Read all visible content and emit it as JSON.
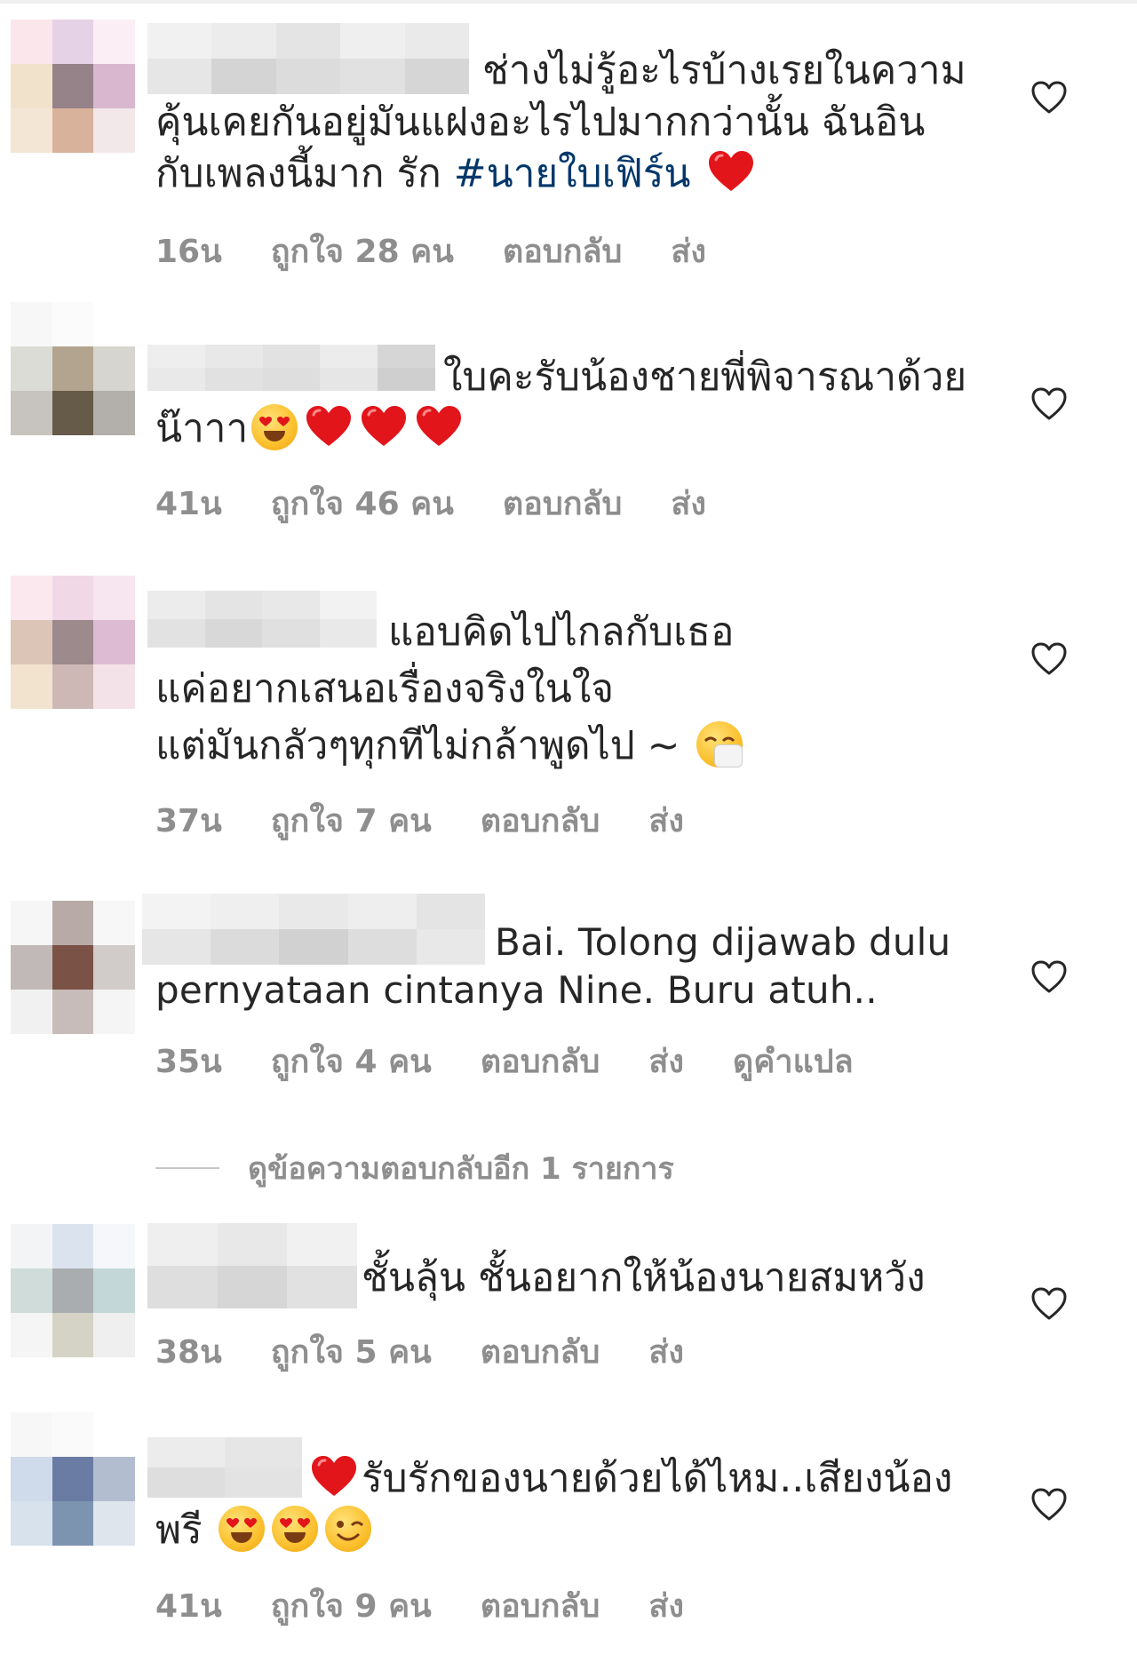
{
  "colors": {
    "text": "#262626",
    "meta": "#8e8e8e",
    "hashtag": "#00376b",
    "heart": "#e2151b"
  },
  "icons": {
    "like": "heart-outline-icon",
    "red_heart": "red-heart-emoji",
    "heart_eyes": "heart-eyes-emoji",
    "sneeze": "sneezing-face-emoji",
    "wink": "winking-face-emoji"
  },
  "comments": [
    {
      "lines": [
        "ช่างไม่รู้อะไรบ้างเรยในความ",
        "คุ้นเคยกันอยู่มันแฝงอะไรไปมากกว่านั้น  ฉันอิน",
        "กับเพลงนี้มาก รัก "
      ],
      "hashtag": "#นายใบเฟิร์น",
      "time": "16น",
      "likes": "ถูกใจ 28 คน",
      "reply": "ตอบกลับ",
      "send": "ส่ง"
    },
    {
      "lines": [
        "ใบคะรับน้องชายพี่พิจารณาด้วย",
        "น๊าาา"
      ],
      "time": "41น",
      "likes": "ถูกใจ 46 คน",
      "reply": "ตอบกลับ",
      "send": "ส่ง"
    },
    {
      "lines": [
        "แอบคิดไปไกลกับเธอ",
        "แค่อยากเสนอเรื่องจริงในใจ",
        "แต่มันกลัวๆทุกทีไม่กล้าพูดไป ~ "
      ],
      "time": "37น",
      "likes": "ถูกใจ 7 คน",
      "reply": "ตอบกลับ",
      "send": "ส่ง"
    },
    {
      "lines": [
        "Bai. Tolong dijawab dulu",
        "pernyataan cintanya Nine. Buru atuh.."
      ],
      "time": "35น",
      "likes": "ถูกใจ 4 คน",
      "reply": "ตอบกลับ",
      "send": "ส่ง",
      "translate": "ดูคำแปล",
      "view_replies": "ดูข้อความตอบกลับอีก 1 รายการ"
    },
    {
      "lines": [
        "ชั้นลุ้น ชั้นอยากให้น้องนายสมหวัง"
      ],
      "time": "38น",
      "likes": "ถูกใจ 5 คน",
      "reply": "ตอบกลับ",
      "send": "ส่ง"
    },
    {
      "lines": [
        "รับรักของนายด้วยได้ไหม..เสียงน้อง",
        "พรี "
      ],
      "time": "41น",
      "likes": "ถูกใจ 9 คน",
      "reply": "ตอบกลับ",
      "send": "ส่ง"
    }
  ]
}
